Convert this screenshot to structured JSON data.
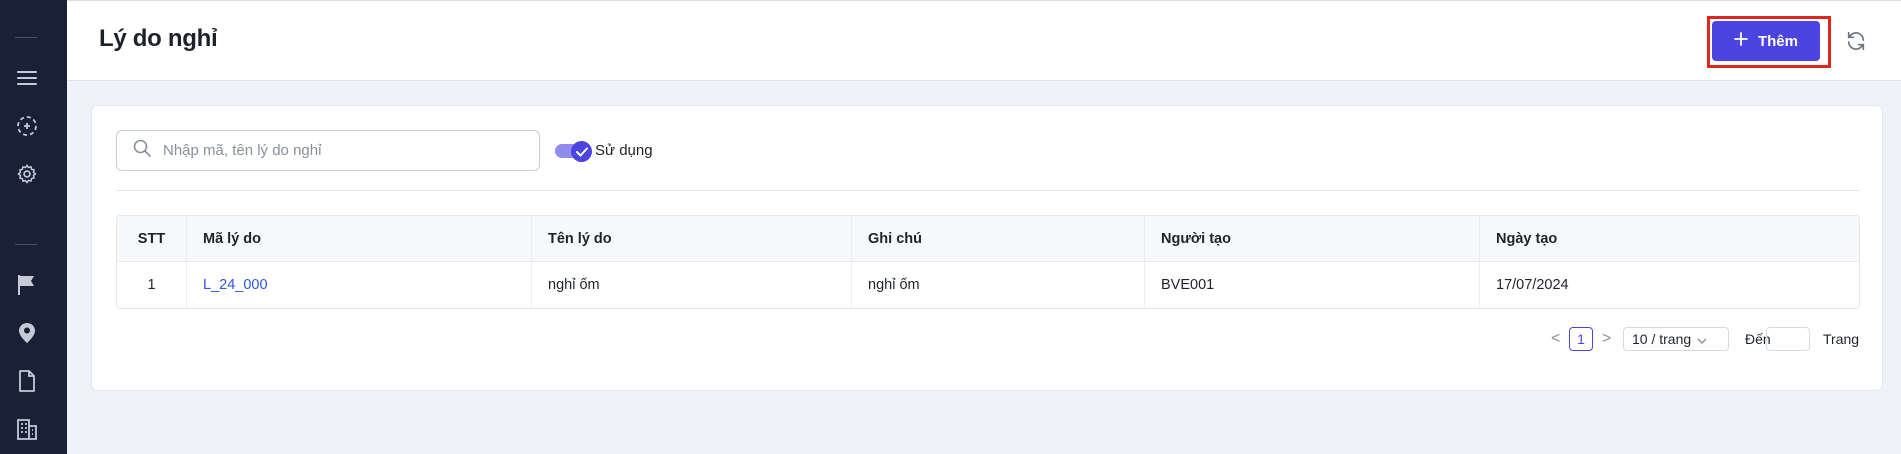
{
  "sidebar": {
    "items": [
      {
        "icon": "menu-icon"
      },
      {
        "icon": "scan-icon"
      },
      {
        "icon": "gear-icon"
      },
      {
        "icon": "flag-icon"
      },
      {
        "icon": "location-pin-icon"
      },
      {
        "icon": "document-icon"
      },
      {
        "icon": "building-icon"
      }
    ]
  },
  "header": {
    "title": "Lý do nghỉ",
    "add_label": "Thêm",
    "accent_color": "#4b44e0",
    "highlight_color": "#e0251b"
  },
  "filters": {
    "search_placeholder": "Nhập mã, tên lý do nghỉ",
    "search_value": "",
    "toggle_label": "Sử dụng",
    "toggle_on": true
  },
  "table": {
    "columns": [
      "STT",
      "Mã lý do",
      "Tên lý do",
      "Ghi chú",
      "Người tạo",
      "Ngày tạo"
    ],
    "rows": [
      {
        "stt": "1",
        "code": "L_24_000",
        "name": "nghỉ ốm",
        "note": "nghỉ ốm",
        "creator": "BVE001",
        "created": "17/07/2024"
      }
    ]
  },
  "pagination": {
    "prev": "<",
    "current": "1",
    "next": ">",
    "page_size": "10 / trang",
    "goto_label": "Đến",
    "goto_suffix": "Trang"
  }
}
